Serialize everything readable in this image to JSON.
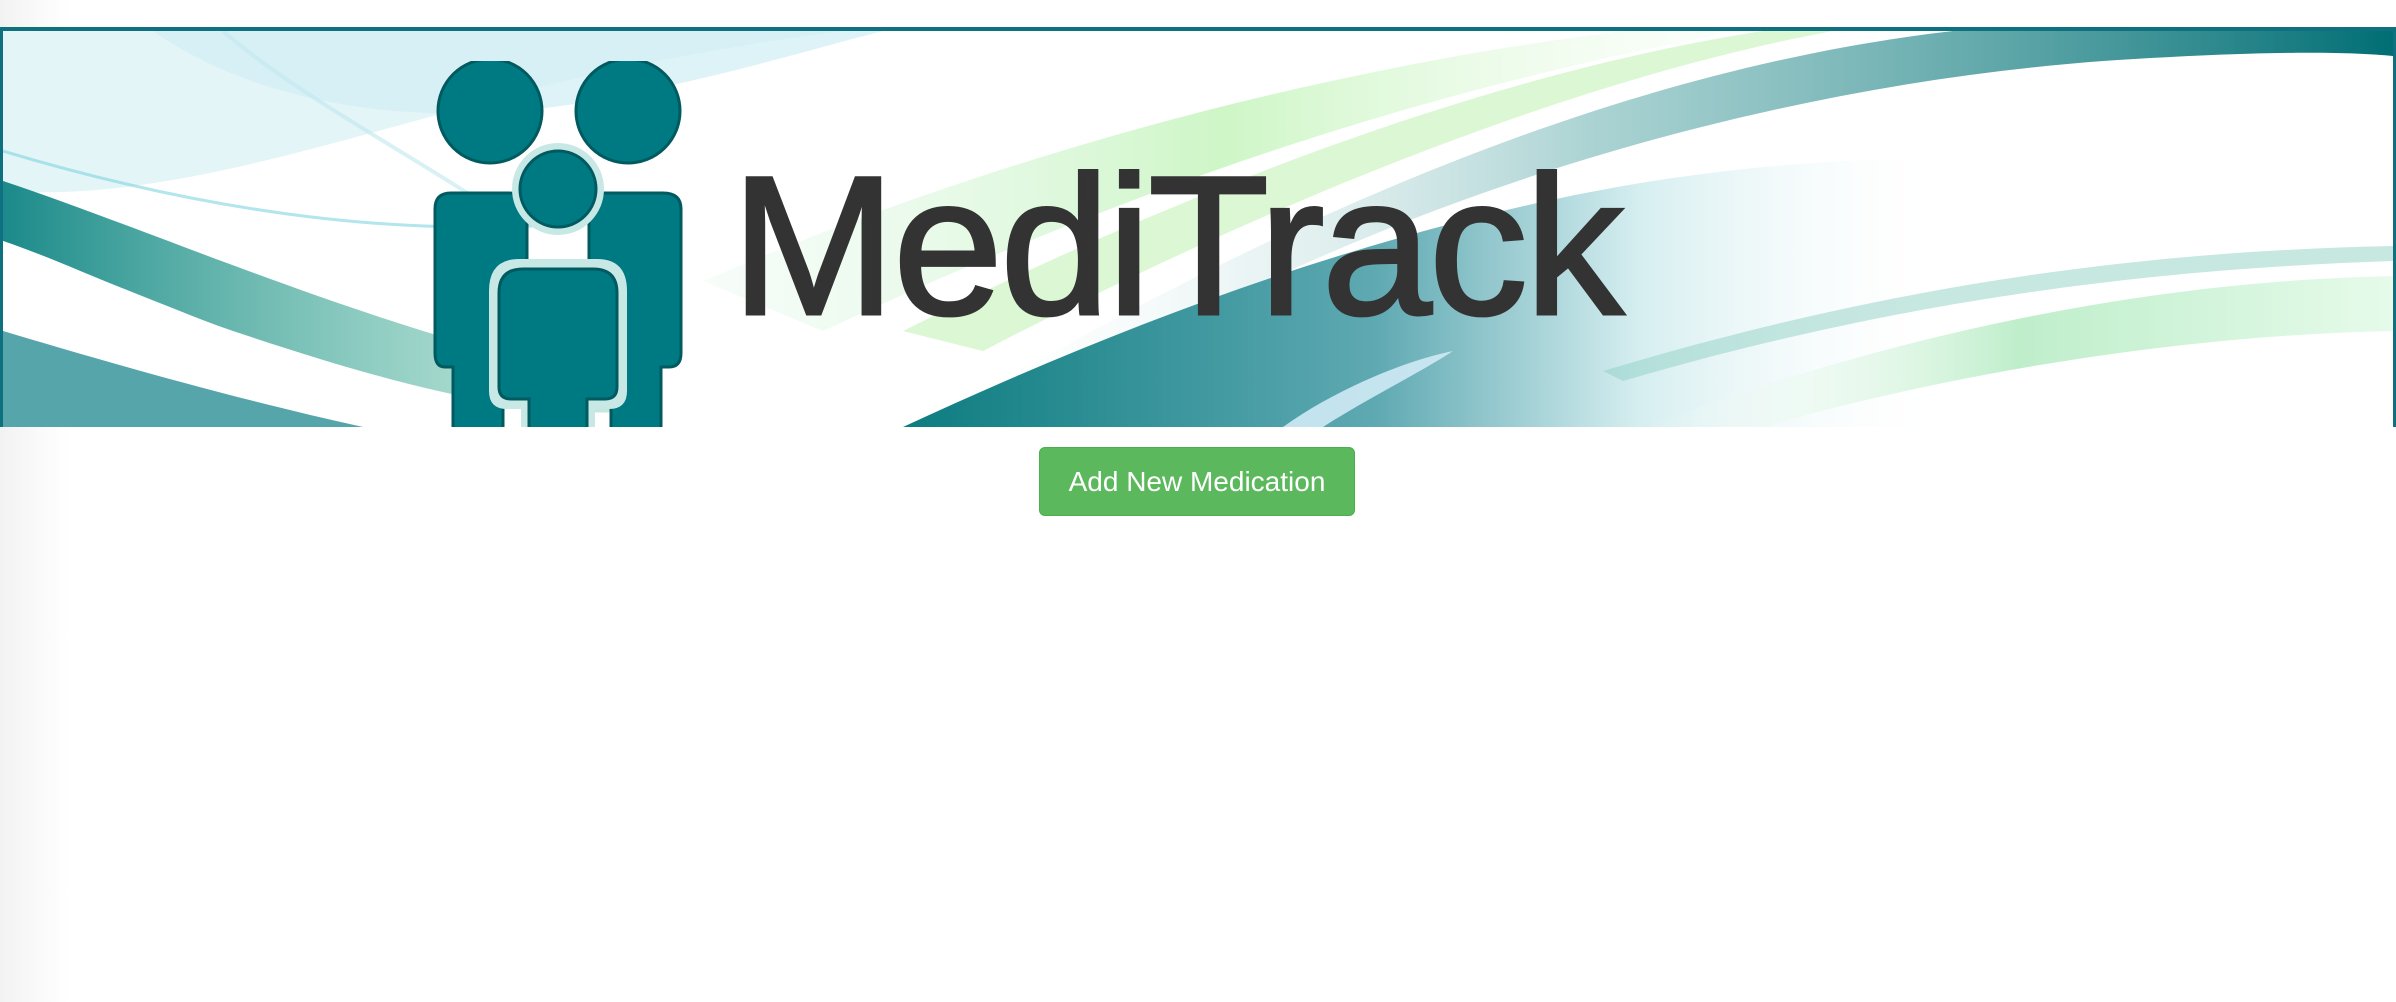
{
  "header": {
    "brand_name": "MediTrack",
    "logo_icon": "family-icon",
    "accent_color": "#007a82",
    "border_color": "#0f7080"
  },
  "main": {
    "add_button_label": "Add New Medication",
    "add_button_color": "#5cb85c"
  }
}
